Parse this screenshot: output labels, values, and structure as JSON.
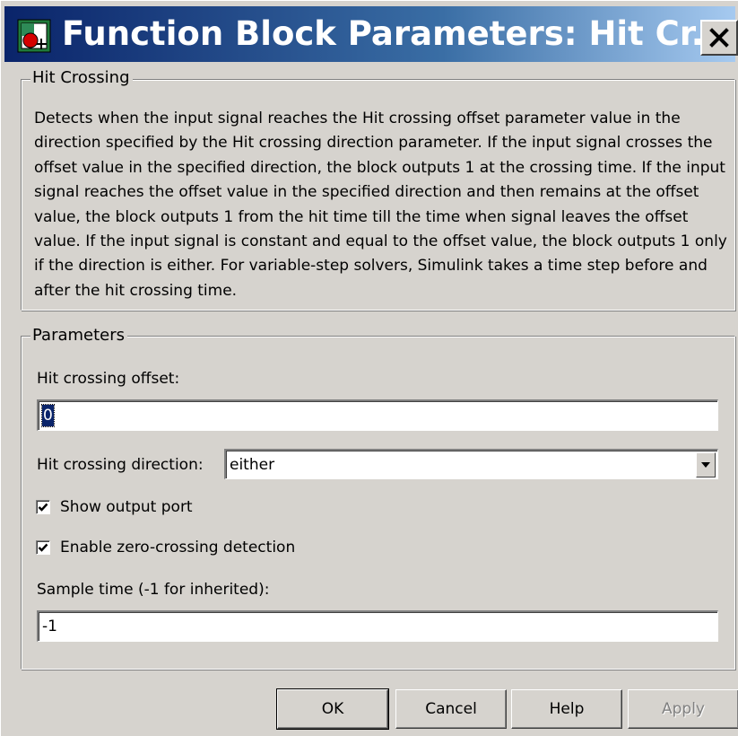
{
  "window": {
    "title": "Function Block Parameters: Hit Cr...",
    "close_label": "close"
  },
  "block_group": {
    "legend": "Hit Crossing",
    "description": "Detects when the input signal reaches the Hit crossing offset parameter value in the direction specified by the Hit crossing direction parameter. If the input signal crosses the offset value in the specified direction, the block outputs 1 at the crossing time. If the input signal reaches the offset value in the specified direction and then remains at the offset value, the block outputs 1 from the hit time till the time when signal leaves the offset value. If the input signal is constant and equal to the offset value, the block outputs 1 only if the direction is either. For variable-step solvers, Simulink takes a time step before and after the hit crossing time."
  },
  "parameters": {
    "legend": "Parameters",
    "offset_label": "Hit crossing offset:",
    "offset_value": "0",
    "direction_label": "Hit crossing direction:",
    "direction_value": "either",
    "show_output_port": {
      "label": "Show output port",
      "checked": true
    },
    "zero_crossing": {
      "label": "Enable zero-crossing detection",
      "checked": true
    },
    "sample_time_label": "Sample time (-1 for inherited):",
    "sample_time_value": "-1"
  },
  "buttons": {
    "ok": "OK",
    "cancel": "Cancel",
    "help": "Help",
    "apply": "Apply"
  },
  "colors": {
    "title_gradient_start": "#0a246a",
    "title_gradient_end": "#a6caf0",
    "dialog_background": "#d6d3ce",
    "selection": "#0a246a"
  },
  "icons": {
    "app": "simulink-block-icon",
    "close": "close-icon",
    "dropdown": "chevron-down-icon",
    "check": "check-icon"
  }
}
